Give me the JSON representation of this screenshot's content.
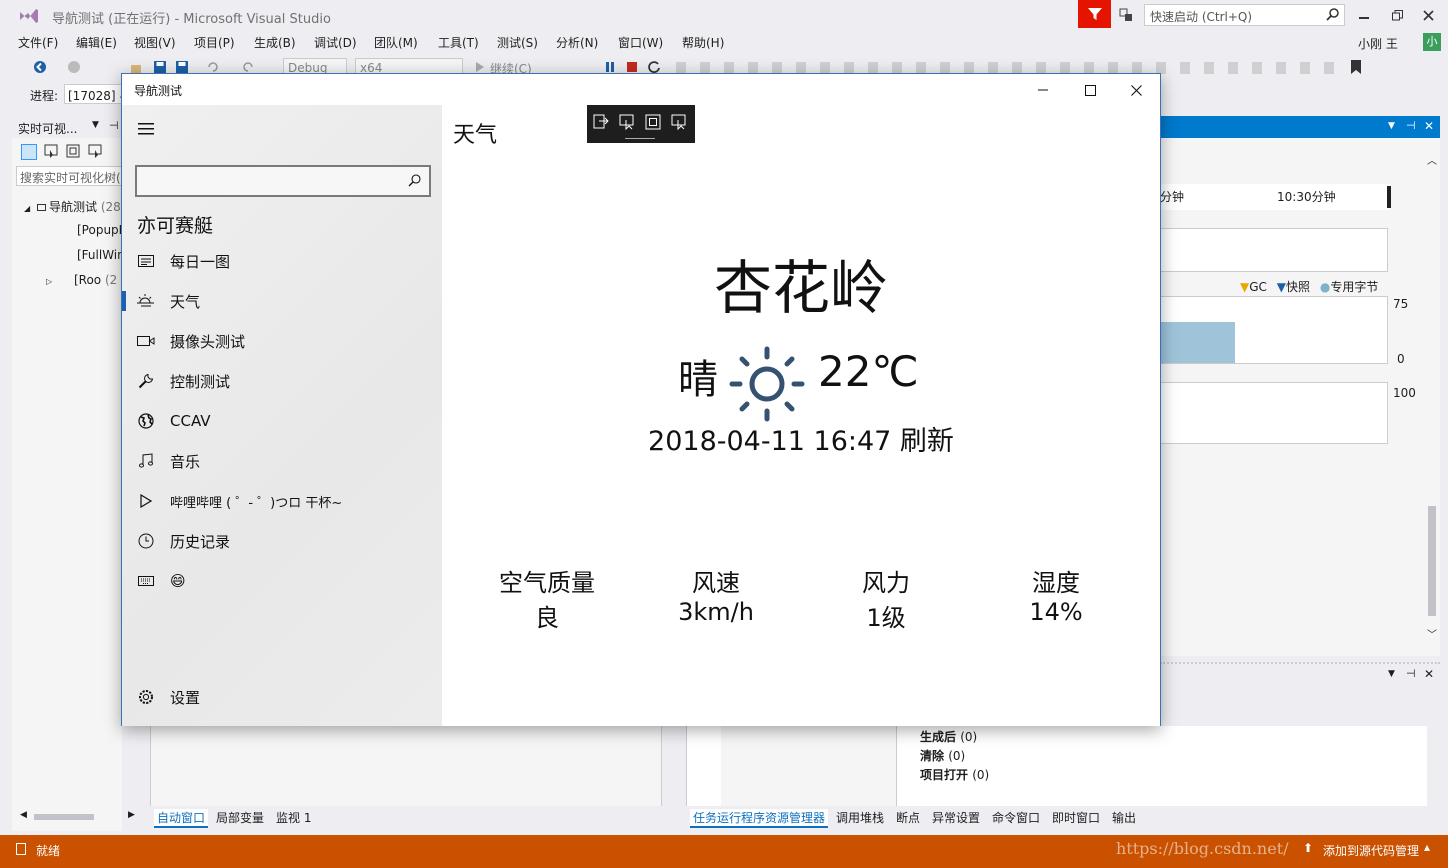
{
  "vs": {
    "title_part1": "导航测试",
    "title_part2": "(正在运行)",
    "title_part3": "- Microsoft Visual Studio",
    "quick_launch_placeholder": "快速启动 (Ctrl+Q)",
    "user_name": "小刚 王",
    "user_avatar": "小",
    "menu": [
      "文件(F)",
      "编辑(E)",
      "视图(V)",
      "项目(P)",
      "生成(B)",
      "调试(D)",
      "团队(M)",
      "工具(T)",
      "测试(S)",
      "分析(N)",
      "窗口(W)",
      "帮助(H)"
    ],
    "toolbar": {
      "config": "Debug",
      "platform": "x64",
      "continue": "继续(C)"
    },
    "process_label": "进程:",
    "process_value": "[17028] 导",
    "left_panel": {
      "title": "实时可视...",
      "search_placeholder": "搜索实时可视化树(",
      "tree": [
        {
          "label": "导航测试",
          "count": "(28"
        },
        {
          "label": "[PopupR",
          "count": ""
        },
        {
          "label": "[FullWin",
          "count": ""
        },
        {
          "label": "[Roo",
          "count": "(2"
        }
      ]
    },
    "diag": {
      "tick1": "分钟",
      "tick2": "10:30分钟",
      "legend_gc": "GC",
      "legend_snapshot": "快照",
      "legend_private": "专用字节",
      "y_top": "75",
      "y_bottom": "0",
      "y_top2": "100",
      "mem_level": 0.62
    },
    "output": {
      "rows": [
        {
          "label": "生成后",
          "val": "(0)"
        },
        {
          "label": "清除",
          "val": "(0)"
        },
        {
          "label": "项目打开",
          "val": "(0)"
        }
      ]
    },
    "bottom_tabs_left": [
      "自动窗口",
      "局部变量",
      "监视 1"
    ],
    "bottom_tabs_right": [
      "任务运行程序资源管理器",
      "调用堆栈",
      "断点",
      "异常设置",
      "命令窗口",
      "即时窗口",
      "输出"
    ],
    "status": {
      "ready": "就绪",
      "source_control": "添加到源代码管理",
      "watermark": "https://blog.csdn.net/"
    }
  },
  "app": {
    "title": "导航测试",
    "page_header": "天气",
    "search_placeholder": "",
    "user_name": "亦可赛艇",
    "nav_items": [
      {
        "label": "每日一图",
        "icon": "newspaper-icon"
      },
      {
        "label": "天气",
        "icon": "weather-icon"
      },
      {
        "label": "摄像头测试",
        "icon": "camera-icon"
      },
      {
        "label": "控制测试",
        "icon": "wrench-icon"
      },
      {
        "label": "CCAV",
        "icon": "globe-icon"
      },
      {
        "label": "音乐",
        "icon": "music-icon"
      },
      {
        "label": "哔哩哔哩 ( ゜- ゜)つロ 干杯~",
        "icon": "play-icon"
      },
      {
        "label": "历史记录",
        "icon": "clock-icon"
      },
      {
        "label": "😄",
        "icon": "keyboard-icon"
      }
    ],
    "settings": "设置",
    "weather": {
      "city": "杏花岭",
      "condition": "晴",
      "temperature": "22℃",
      "updated": "2018-04-11 16:47 刷新",
      "stats": [
        {
          "label": "空气质量",
          "value": "良"
        },
        {
          "label": "风速",
          "value": "3km/h"
        },
        {
          "label": "风力",
          "value": "1级"
        },
        {
          "label": "湿度",
          "value": "14%"
        }
      ]
    }
  },
  "colors": {
    "accent": "#1a5fb4",
    "status_bar": "#ca5100",
    "vs_blue": "#007acc",
    "filter_red": "#e51400",
    "mem_fill": "#9fc4da"
  }
}
